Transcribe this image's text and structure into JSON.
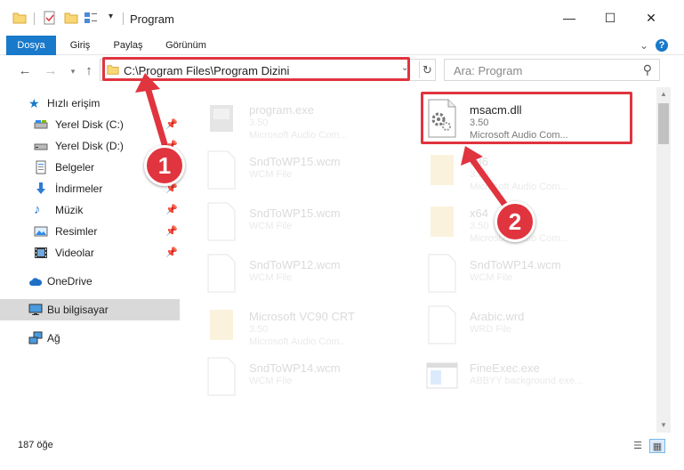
{
  "window": {
    "title": "Program",
    "minimize": "—",
    "maximize": "☐",
    "close": "✕"
  },
  "ribbon": {
    "tabs": [
      "Dosya",
      "Giriş",
      "Paylaş",
      "Görünüm"
    ],
    "help": "?"
  },
  "address": {
    "path": "C:\\Program Files\\Program Dizini",
    "search_placeholder": "Ara: Program"
  },
  "sidebar": {
    "quick_access": "Hızlı erişim",
    "items": [
      {
        "label": "Yerel Disk (C:)",
        "icon": "drive-icon",
        "pinned": true
      },
      {
        "label": "Yerel Disk (D:)",
        "icon": "drive-icon",
        "pinned": true
      },
      {
        "label": "Belgeler",
        "icon": "documents-icon",
        "pinned": true
      },
      {
        "label": "İndirmeler",
        "icon": "download-icon",
        "pinned": true
      },
      {
        "label": "Müzik",
        "icon": "music-icon",
        "pinned": true
      },
      {
        "label": "Resimler",
        "icon": "pictures-icon",
        "pinned": true
      },
      {
        "label": "Videolar",
        "icon": "videos-icon",
        "pinned": true
      }
    ],
    "onedrive": "OneDrive",
    "this_pc": "Bu bilgisayar",
    "network": "Ağ"
  },
  "files": [
    {
      "name": "program.exe",
      "line2": "3.50",
      "line3": "Microsoft Audio Com...",
      "icon": "exe-icon",
      "faded": true
    },
    {
      "name": "msacm.dll",
      "line2": "3.50",
      "line3": "Microsoft Audio Com...",
      "icon": "dll-gear-icon",
      "faded": false
    },
    {
      "name": "SndToWP15.wcm",
      "line2": "WCM File",
      "line3": "",
      "icon": "blank-file-icon",
      "faded": true
    },
    {
      "name": "x86",
      "line2": "3.50",
      "line3": "Microsoft Audio Com...",
      "icon": "folder-file-icon",
      "faded": true
    },
    {
      "name": "SndToWP15.wcm",
      "line2": "WCM File",
      "line3": "",
      "icon": "blank-file-icon",
      "faded": true
    },
    {
      "name": "x64",
      "line2": "3.50",
      "line3": "Microsoft Audio Com...",
      "icon": "folder-file-icon",
      "faded": true
    },
    {
      "name": "SndToWP12.wcm",
      "line2": "WCM File",
      "line3": "",
      "icon": "blank-file-icon",
      "faded": true
    },
    {
      "name": "SndToWP14.wcm",
      "line2": "WCM File",
      "line3": "",
      "icon": "blank-file-icon",
      "faded": true
    },
    {
      "name": "Microsoft VC90 CRT",
      "line2": "3.50",
      "line3": "Microsoft Audio Com...",
      "icon": "folder-file-icon",
      "faded": true
    },
    {
      "name": "Arabic.wrd",
      "line2": "WRD File",
      "line3": "",
      "icon": "blank-file-icon",
      "faded": true
    },
    {
      "name": "SndToWP14.wcm",
      "line2": "WCM File",
      "line3": "",
      "icon": "blank-file-icon",
      "faded": true
    },
    {
      "name": "FineExec.exe",
      "line2": "ABBYY background exe...",
      "line3": "",
      "icon": "app-window-icon",
      "faded": true
    }
  ],
  "status": {
    "count": "187 öğe"
  },
  "annotations": {
    "badge1": "1",
    "badge2": "2"
  },
  "colors": {
    "accent": "#1979ca",
    "highlight": "#e0343f",
    "selected": "#cce8ff"
  }
}
